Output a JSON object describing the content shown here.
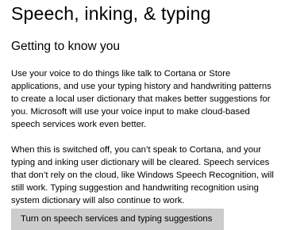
{
  "page": {
    "title": "Speech, inking, & typing"
  },
  "section": {
    "title": "Getting to know you",
    "paragraph1": [
      "Use your voice to do things like talk to Cortana or Store",
      "applications, and use your typing history and handwriting patterns",
      "to create a local user dictionary that makes better suggestions for",
      "you. Microsoft will use your voice input to make cloud-based",
      "speech services work even better."
    ],
    "paragraph2": [
      "When this is switched off, you can’t speak to Cortana, and your",
      "typing and inking user dictionary will be cleared. Speech services",
      "that don’t rely on the cloud, like Windows Speech Recognition, will",
      "still work. Typing suggestion and handwriting recognition using",
      "system dictionary will also continue to work."
    ],
    "button_label": "Turn on speech services and typing suggestions"
  },
  "colors": {
    "background": "#ffffff",
    "text": "#000000",
    "button_background": "#cccccc"
  }
}
